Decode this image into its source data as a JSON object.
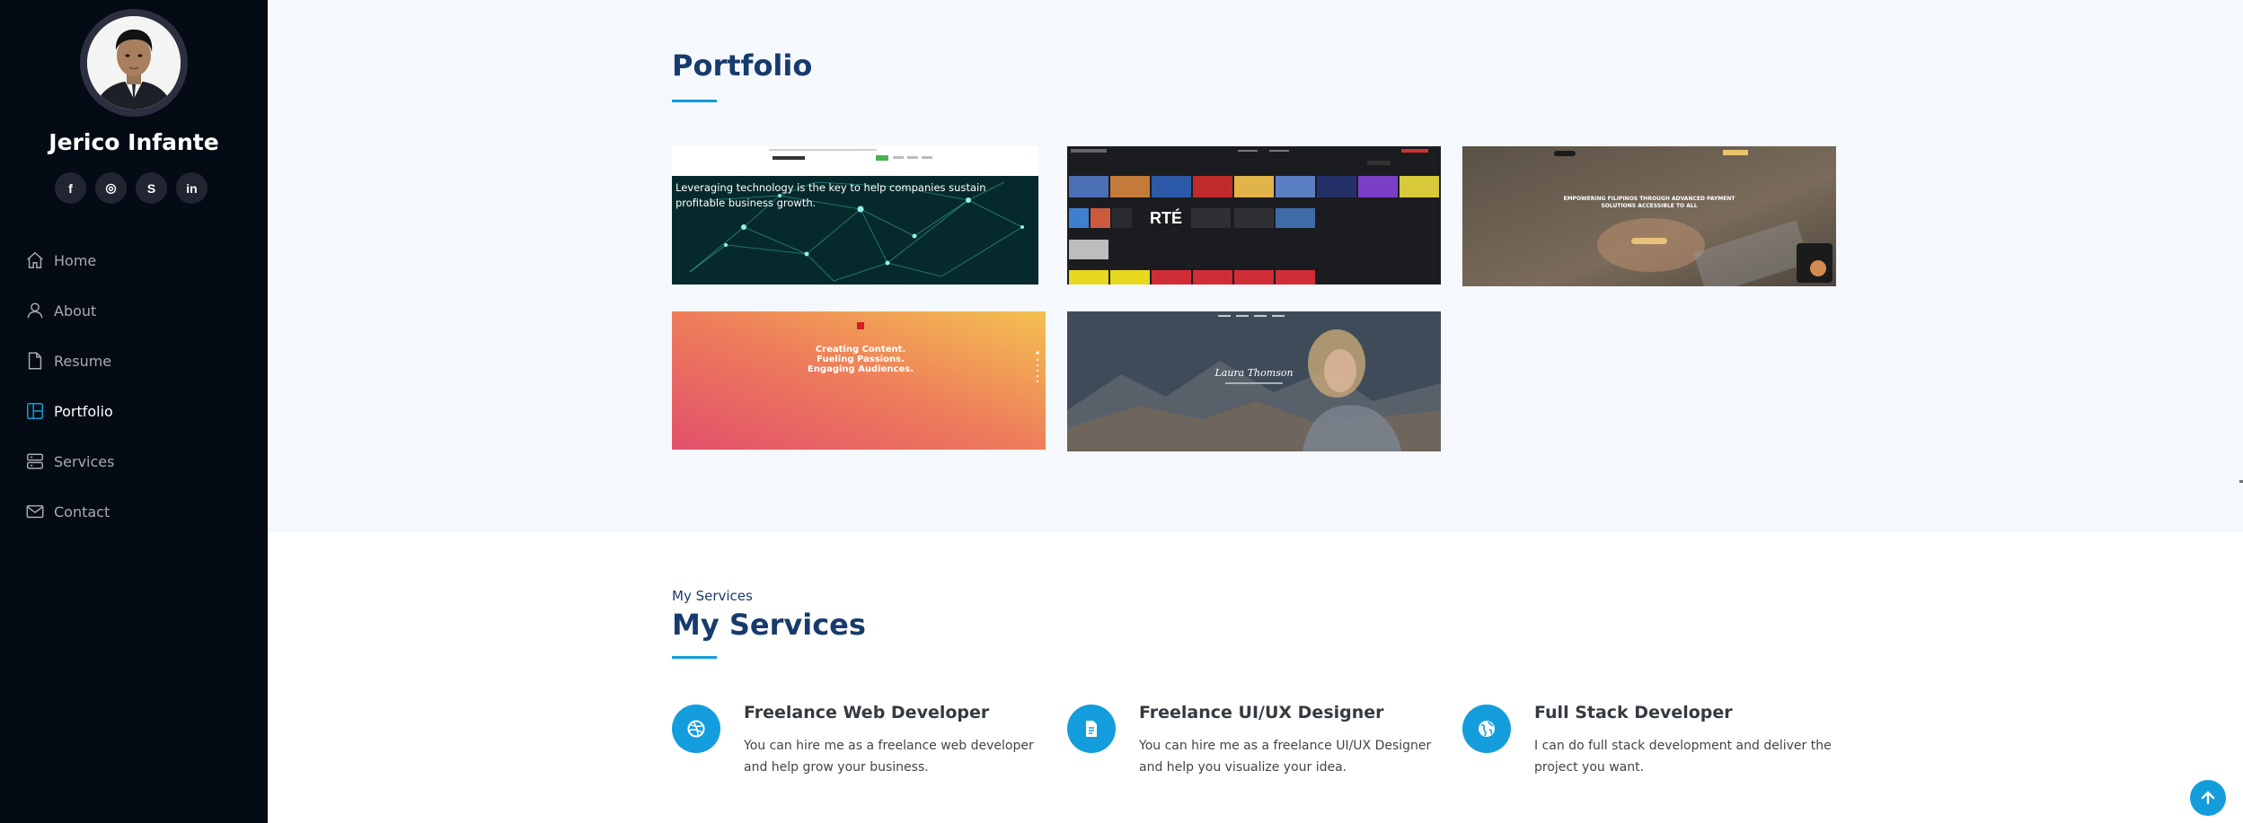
{
  "profile": {
    "name": "Jerico Infante"
  },
  "social": [
    {
      "label": "f",
      "icon": "facebook-icon"
    },
    {
      "label": "◎",
      "icon": "instagram-icon"
    },
    {
      "label": "S",
      "icon": "skype-icon"
    },
    {
      "label": "in",
      "icon": "linkedin-icon"
    }
  ],
  "nav": {
    "items": [
      {
        "label": "Home",
        "icon": "home-icon"
      },
      {
        "label": "About",
        "icon": "person-icon"
      },
      {
        "label": "Resume",
        "icon": "file-icon"
      },
      {
        "label": "Portfolio",
        "icon": "portfolio-icon",
        "active": true
      },
      {
        "label": "Services",
        "icon": "server-icon"
      },
      {
        "label": "Contact",
        "icon": "envelope-icon"
      }
    ]
  },
  "portfolio": {
    "title": "Portfolio",
    "item1_hero_text": "Leveraging technology is the key to help companies sustain profitable business growth.",
    "item2_logo_text": "RTÉ",
    "item3_hero_text": "EMPOWERING FILIPINOS THROUGH ADVANCED PAYMENT SOLUTIONS ACCESSIBLE TO ALL",
    "item4_hero_text_1": "Creating Content.",
    "item4_hero_text_2": "Fueling Passions.",
    "item4_hero_text_3": "Engaging Audiences.",
    "item5_name_text": "Laura Thomson"
  },
  "services": {
    "subtitle": "My Services",
    "title": "My Services",
    "items": [
      {
        "title": "Freelance Web Developer",
        "desc": "You can hire me as a freelance web developer and help grow your business.",
        "icon": "dribbble-icon"
      },
      {
        "title": "Freelance UI/UX Designer",
        "desc": "You can hire me as a freelance UI/UX Designer and help you visualize your idea.",
        "icon": "document-icon"
      },
      {
        "title": "Full Stack Developer",
        "desc": "I can do full stack development and deliver the project you want.",
        "icon": "globe-icon"
      }
    ]
  },
  "colors": {
    "accent": "#149ddd",
    "sidebar_bg": "#040b14",
    "heading": "#173b6c"
  }
}
